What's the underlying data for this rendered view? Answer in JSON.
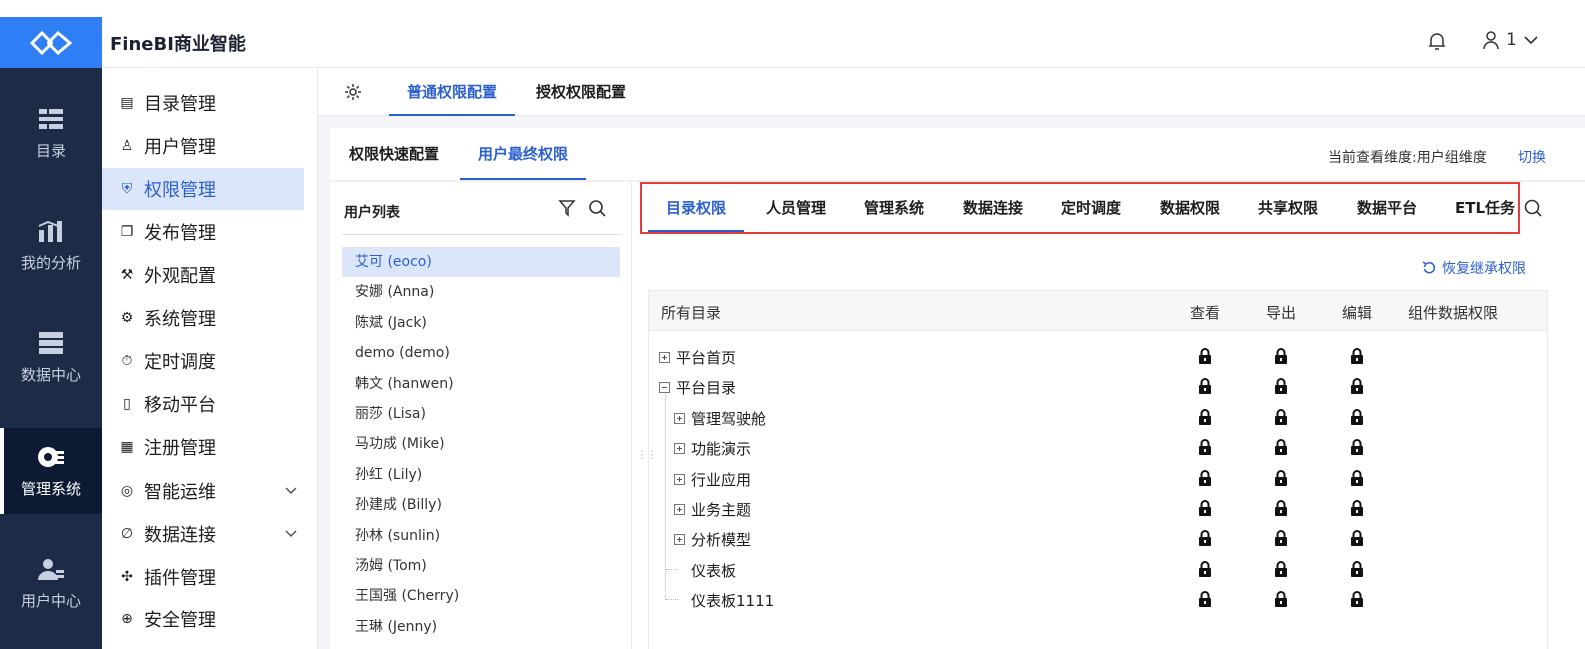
{
  "app": {
    "title": "FineBI商业智能",
    "user_name": "1"
  },
  "rail": [
    {
      "label": "目录",
      "icon": "catalog-icon"
    },
    {
      "label": "我的分析",
      "icon": "analysis-icon"
    },
    {
      "label": "数据中心",
      "icon": "data-center-icon"
    },
    {
      "label": "管理系统",
      "icon": "admin-icon",
      "active": true
    },
    {
      "label": "用户中心",
      "icon": "user-center-icon"
    }
  ],
  "menu": [
    {
      "label": "目录管理",
      "icon": "list-icon"
    },
    {
      "label": "用户管理",
      "icon": "user-icon"
    },
    {
      "label": "权限管理",
      "icon": "shield-icon",
      "active": true
    },
    {
      "label": "发布管理",
      "icon": "publish-icon"
    },
    {
      "label": "外观配置",
      "icon": "brush-icon"
    },
    {
      "label": "系统管理",
      "icon": "gear-icon"
    },
    {
      "label": "定时调度",
      "icon": "timer-icon"
    },
    {
      "label": "移动平台",
      "icon": "mobile-icon"
    },
    {
      "label": "注册管理",
      "icon": "register-icon"
    },
    {
      "label": "智能运维",
      "icon": "ops-icon",
      "expandable": true
    },
    {
      "label": "数据连接",
      "icon": "link-icon",
      "expandable": true
    },
    {
      "label": "插件管理",
      "icon": "plugin-icon"
    },
    {
      "label": "安全管理",
      "icon": "security-icon"
    }
  ],
  "subtabs": [
    {
      "label": "普通权限配置",
      "active": true
    },
    {
      "label": "授权权限配置"
    }
  ],
  "panel_tabs": [
    {
      "label": "权限快速配置"
    },
    {
      "label": "用户最终权限",
      "active": true
    }
  ],
  "dimension": {
    "text": "当前查看维度:用户组维度",
    "switch_label": "切换"
  },
  "user_list": {
    "title": "用户列表",
    "users": [
      "艾可 (eoco)",
      "安娜 (Anna)",
      "陈斌 (Jack)",
      "demo (demo)",
      "韩文 (hanwen)",
      "丽莎 (Lisa)",
      "马功成 (Mike)",
      "孙红 (Lily)",
      "孙建成 (Billy)",
      "孙林 (sunlin)",
      "汤姆 (Tom)",
      "王国强 (Cherry)",
      "王琳 (Jenny)"
    ],
    "selected_index": 0
  },
  "dimension_tabs": [
    "目录权限",
    "人员管理",
    "管理系统",
    "数据连接",
    "定时调度",
    "数据权限",
    "共享权限",
    "数据平台",
    "ETL任务"
  ],
  "restore_label": "恢复继承权限",
  "table": {
    "headers": [
      "所有目录",
      "查看",
      "导出",
      "编辑",
      "组件数据权限"
    ],
    "rows": [
      {
        "label": "平台首页",
        "node": "plus",
        "level": 0
      },
      {
        "label": "平台目录",
        "node": "minus",
        "level": 0
      },
      {
        "label": "管理驾驶舱",
        "node": "plus",
        "level": 1
      },
      {
        "label": "功能演示",
        "node": "plus",
        "level": 1
      },
      {
        "label": "行业应用",
        "node": "plus",
        "level": 1
      },
      {
        "label": "业务主题",
        "node": "plus",
        "level": 1
      },
      {
        "label": "分析模型",
        "node": "plus",
        "level": 1
      },
      {
        "label": "仪表板",
        "node": "leaf",
        "level": 1
      },
      {
        "label": "仪表板1111",
        "node": "leaf",
        "level": 1
      }
    ]
  }
}
